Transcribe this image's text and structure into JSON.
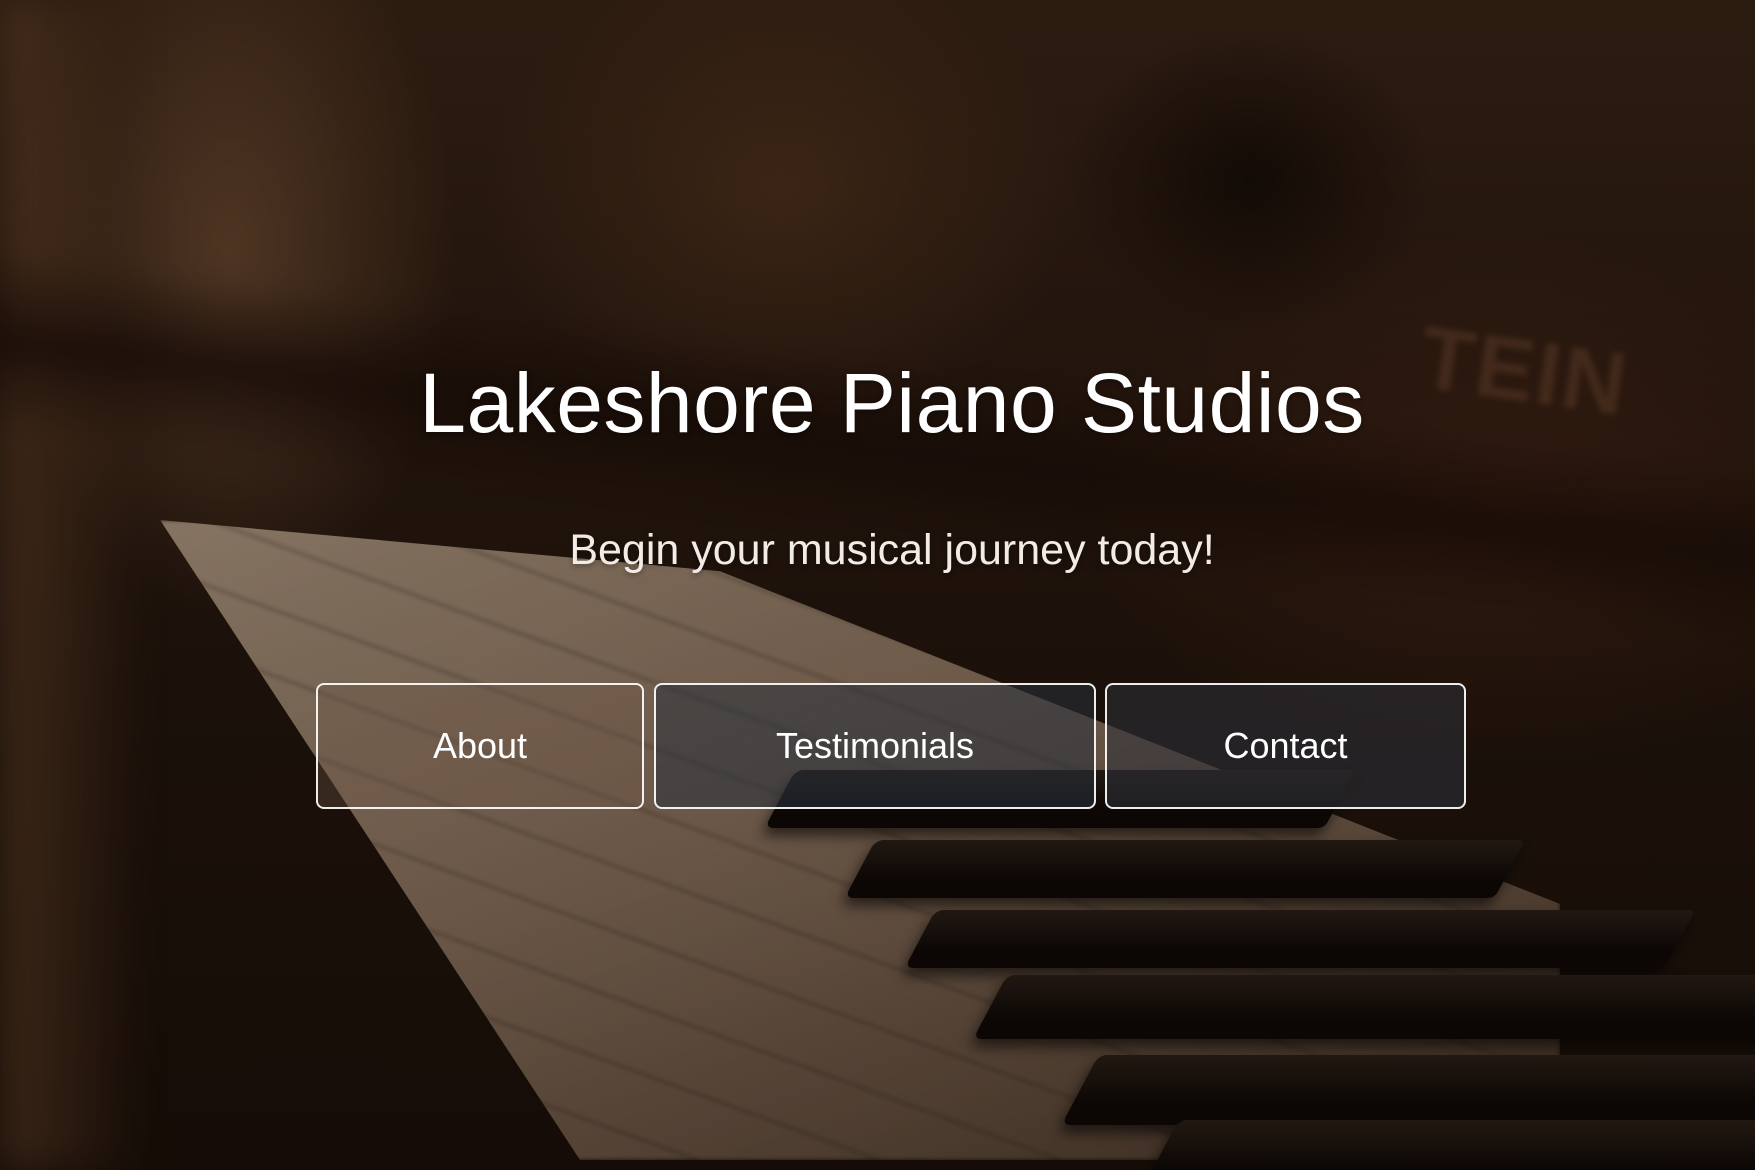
{
  "hero": {
    "title": "Lakeshore Piano Studios",
    "subtitle": "Begin your musical journey today!",
    "background_brand_text": "TEIN"
  },
  "nav": {
    "buttons": [
      {
        "label": "About"
      },
      {
        "label": "Testimonials"
      },
      {
        "label": "Contact"
      }
    ]
  },
  "colors": {
    "text": "#ffffff",
    "button_border": "#ffffff",
    "background_dark": "#1a0f09"
  }
}
